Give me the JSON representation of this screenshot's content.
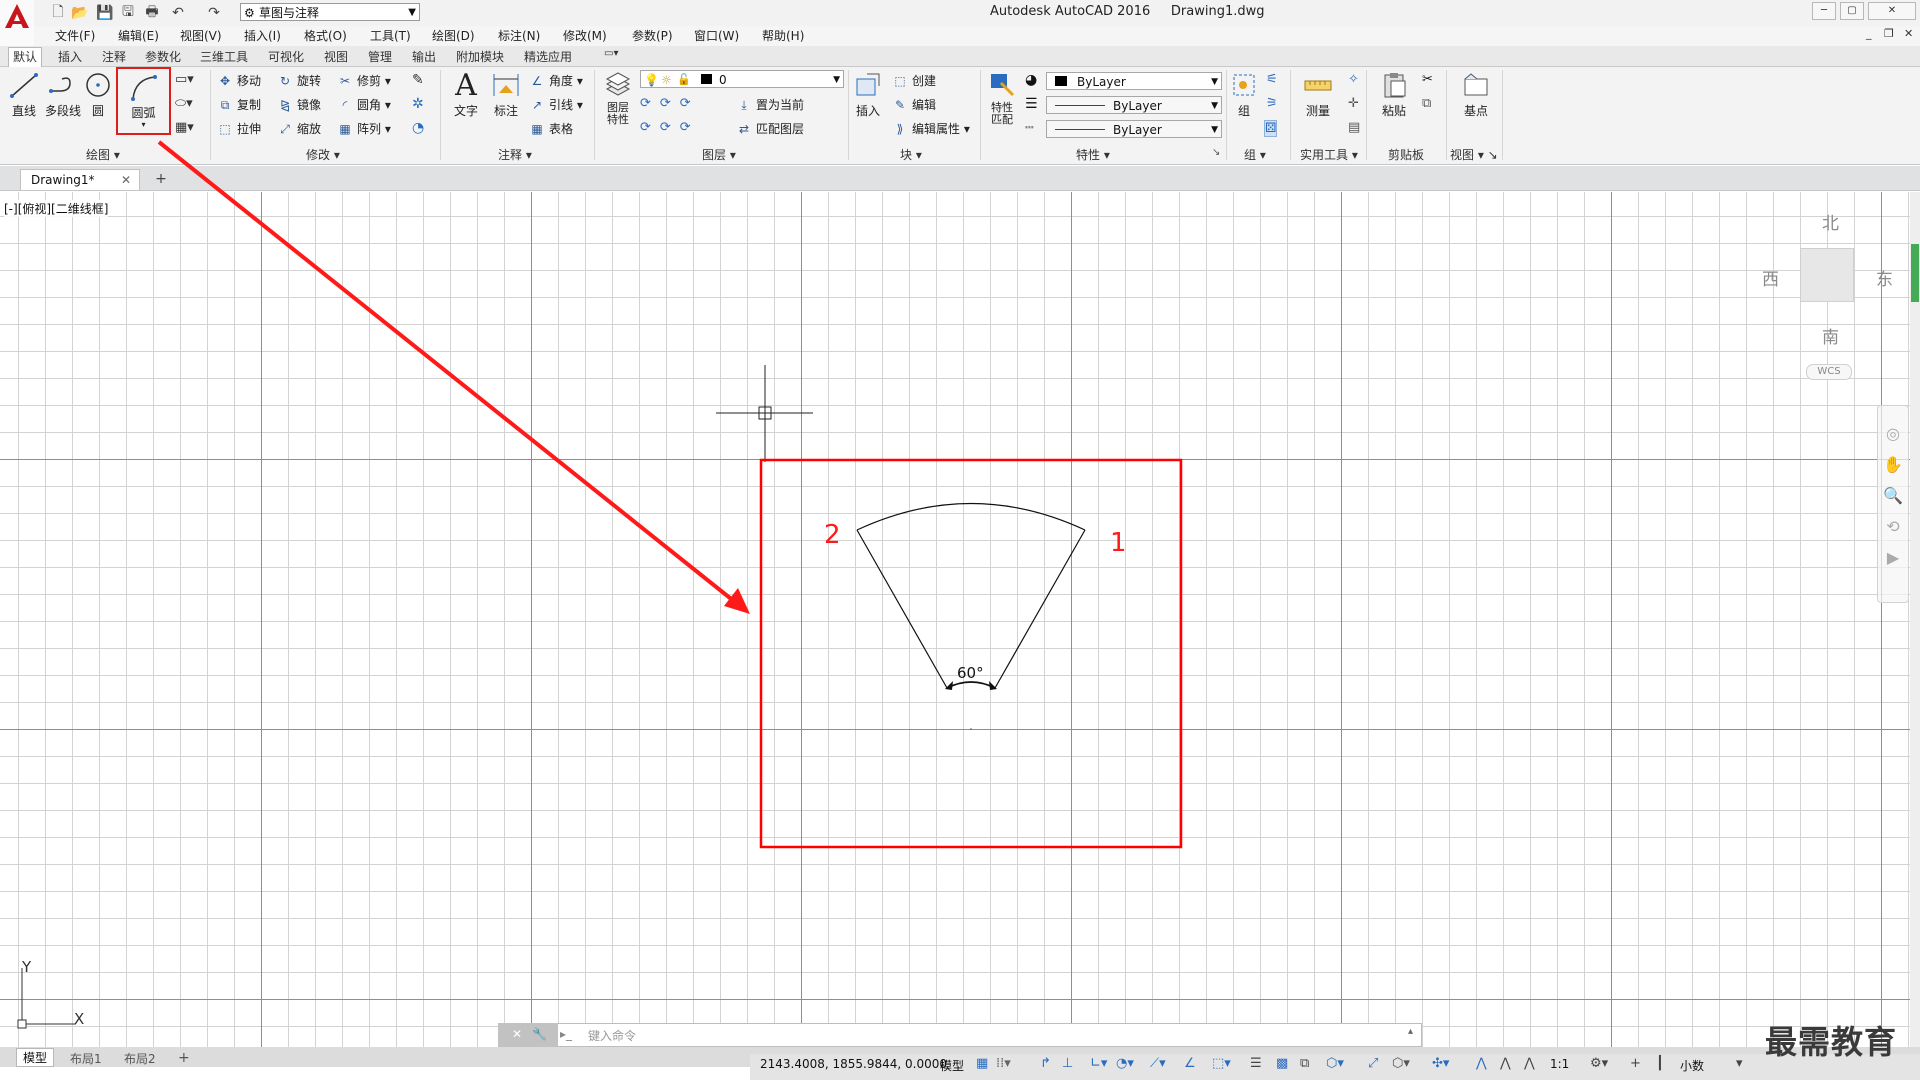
{
  "titlebar": {
    "app_title": "Autodesk AutoCAD 2016",
    "doc_title": "Drawing1.dwg",
    "workspace": "草图与注释",
    "win_controls": [
      "─",
      "▢",
      "✕"
    ]
  },
  "menubar": {
    "items": [
      "文件(F)",
      "编辑(E)",
      "视图(V)",
      "插入(I)",
      "格式(O)",
      "工具(T)",
      "绘图(D)",
      "标注(N)",
      "修改(M)",
      "参数(P)",
      "窗口(W)",
      "帮助(H)"
    ]
  },
  "ribbon_tabs": [
    "默认",
    "插入",
    "注释",
    "参数化",
    "三维工具",
    "可视化",
    "视图",
    "管理",
    "输出",
    "附加模块",
    "精选应用"
  ],
  "ribbon": {
    "draw": {
      "title": "绘图",
      "line": "直线",
      "polyline": "多段线",
      "circle": "圆",
      "arc": "圆弧"
    },
    "modify": {
      "title": "修改",
      "move": "移动",
      "rotate": "旋转",
      "trim": "修剪",
      "copy": "复制",
      "mirror": "镜像",
      "fillet": "圆角",
      "stretch": "拉伸",
      "scale": "缩放",
      "array": "阵列"
    },
    "annotation": {
      "title": "注释",
      "text": "文字",
      "dimension": "标注",
      "angular": "角度",
      "leader": "引线",
      "table": "表格"
    },
    "layers": {
      "title": "图层",
      "layer_props": "图层\n特性",
      "layer_value": "0",
      "set_current": "置为当前",
      "match_layer": "匹配图层"
    },
    "block": {
      "title": "块",
      "insert": "插入",
      "create": "创建",
      "edit": "编辑",
      "edit_attr": "编辑属性"
    },
    "properties": {
      "title": "特性",
      "match": "特性\n匹配",
      "color": "ByLayer",
      "linetype": "ByLayer",
      "lineweight": "ByLayer"
    },
    "groups": {
      "title": "组",
      "group": "组"
    },
    "utilities": {
      "title": "实用工具",
      "measure": "测量"
    },
    "clipboard": {
      "title": "剪贴板",
      "paste": "粘贴"
    },
    "view": {
      "title": "视图",
      "base": "基点"
    }
  },
  "doc_tab": {
    "label": "Drawing1*",
    "close": "✕",
    "new": "+"
  },
  "viewport_label": "[-][俯视][二维线框]",
  "viewcube": {
    "north": "北",
    "south": "南",
    "east": "东",
    "west": "西",
    "wcs": "WCS"
  },
  "drawing": {
    "angle_label": "60°",
    "point1": "1",
    "point2": "2",
    "accent": "#ff0000"
  },
  "ucs": {
    "y": "Y",
    "x": "X"
  },
  "command": {
    "placeholder": "键入命令"
  },
  "layout_tabs": [
    "模型",
    "布局1",
    "布局2"
  ],
  "status": {
    "coords": "2143.4008, 1855.9844, 0.0000",
    "model": "模型",
    "scale": "1:1",
    "units": "小数"
  },
  "watermark": "最需教育"
}
